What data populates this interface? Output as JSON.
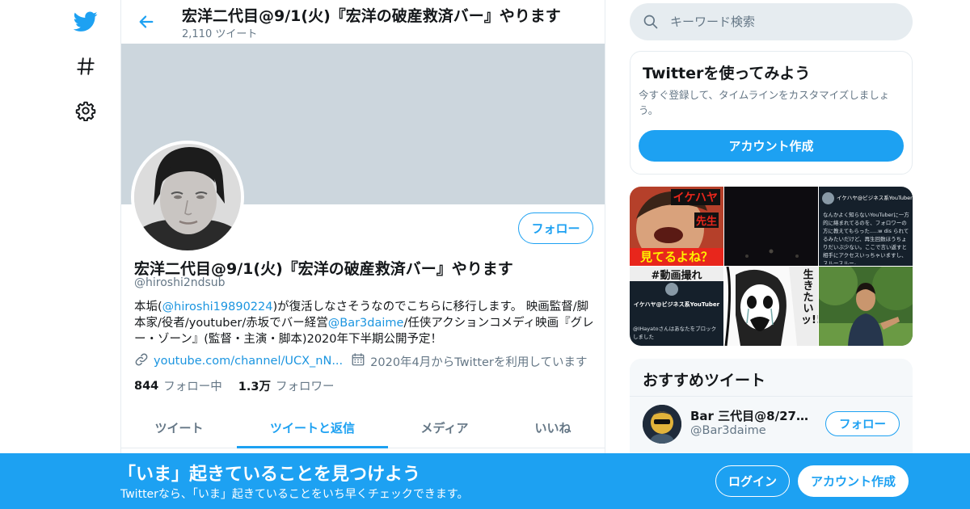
{
  "colors": {
    "accent": "#1da1f2",
    "link": "#1b95e0",
    "text_primary": "#14171a",
    "text_secondary": "#657786",
    "banner": "#ccd6dd",
    "border": "#e6ecf0"
  },
  "nav": {
    "icons": [
      "twitter-bird-icon",
      "hashtag-icon",
      "gear-icon"
    ]
  },
  "header": {
    "title": "宏洋二代目@9/1(火)『宏洋の破産救済バー』やります",
    "tweet_count": "2,110 ツイート"
  },
  "profile": {
    "follow_label": "フォロー",
    "name": "宏洋二代目@9/1(火)『宏洋の破産救済バー』やります",
    "handle": "@hiroshi2ndsub",
    "bio": {
      "p1": "本垢(",
      "mention1": "@hiroshi19890224",
      "p2": ")が復活しなさそうなのでこちらに移行します。 映画監督/脚本家/役者/youtuber/赤坂でバー経営",
      "mention2": "@Bar3daime",
      "p3": "/任侠アクションコメディ映画『グレー・ゾーン』(監督・主演・脚本)2020年下半期公開予定！"
    },
    "link": "youtube.com/channel/UCX_nN...",
    "joined": "2020年4月からTwitterを利用しています",
    "following_count": "844",
    "following_label": "フォロー中",
    "followers_count": "1.3万",
    "followers_label": "フォロワー"
  },
  "tabs": [
    {
      "label": "ツイート",
      "active": false
    },
    {
      "label": "ツイートと返信",
      "active": true
    },
    {
      "label": "メディア",
      "active": false
    },
    {
      "label": "いいね",
      "active": false
    }
  ],
  "search": {
    "placeholder": "キーワード検索"
  },
  "signup_card": {
    "title": "Twitterを使ってみよう",
    "description": "今すぐ登録して、タイムラインをカスタマイズしましょう。",
    "button": "アカウント作成"
  },
  "media": {
    "t1_line1": "イケハヤ",
    "t1_line2": "先生",
    "t1_line3": "見てるよね？",
    "t3_header": "イケハヤ@ビジネス系YouTuber",
    "t3_body": "なんかよく知らないYouTuberに一方的に絡まれてるのを、フォロワーの方に教えてもらった.....w dis られてるみたいだけど、再生回数ほうちょりだいぶ少ない。ここで言い返すと相手にアクセスいっちゃいますし、スルースルー。",
    "t4_title": "#動画撮れ",
    "t4_name": "イケハヤ@ビジネス系YouTuber",
    "t4_block": "@IHayatoさんはあなたをブロックしました",
    "t5_text": "生きたいッ!!"
  },
  "recommended": {
    "title": "おすすめツイート",
    "account_name": "Bar 三代目@8/27集...",
    "account_handle": "@Bar3daime",
    "follow_label": "フォロー"
  },
  "bottom_bar": {
    "title": "「いま」起きていることを見つけよう",
    "subtitle": "Twitterなら、「いま」起きていることをいち早くチェックできます。",
    "login_label": "ログイン",
    "signup_label": "アカウント作成"
  }
}
